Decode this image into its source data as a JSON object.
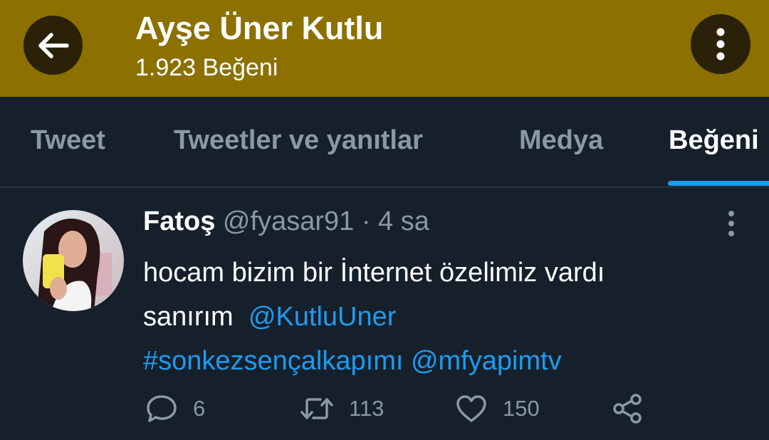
{
  "header": {
    "title": "Ayşe Üner Kutlu",
    "subtitle": "1.923 Beğeni",
    "background_color": "#8c7000",
    "back_icon": "arrow-left-icon",
    "more_icon": "vertical-dots-icon"
  },
  "tabs": [
    {
      "label": "Tweet",
      "active": false
    },
    {
      "label": "Tweetler ve yanıtlar",
      "active": false
    },
    {
      "label": "Medya",
      "active": false
    },
    {
      "label": "Beğeni",
      "active": true
    }
  ],
  "accent_color": "#1d9bf0",
  "tweet": {
    "name": "Fatoş",
    "handle": "@fyasar91",
    "separator": "·",
    "time": "4 sa",
    "text_line1": "hocam bizim bir İnternet özelimiz vardı",
    "text_line2": "sanırım",
    "mention1": "@KutluUner",
    "hashtag": "#sonkezsençalkapımı",
    "mention2": "@mfyapimtv",
    "replies": "6",
    "retweets": "113",
    "likes": "150"
  }
}
